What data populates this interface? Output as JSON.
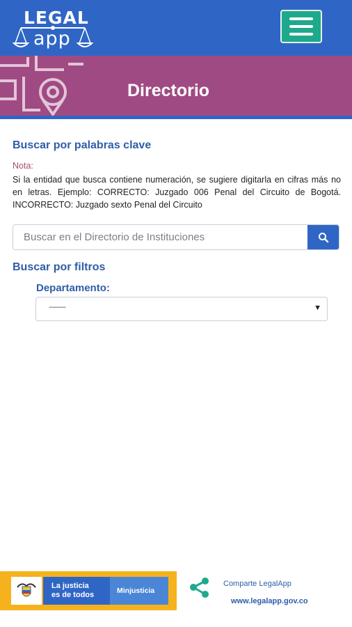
{
  "header": {
    "logo_top": "LEGAL",
    "logo_bottom": "app",
    "menu_icon": "hamburger-icon"
  },
  "banner": {
    "title": "Directorio"
  },
  "keyword_search": {
    "title": "Buscar por palabras clave",
    "note_label": "Nota:",
    "note_text": "Si la entidad que busca contiene numeración, se sugiere digitarla en cifras más no en letras. Ejemplo: CORRECTO: Juzgado 006 Penal del Circuito de Bogotá. INCORRECTO: Juzgado sexto Penal del Circuito",
    "search_placeholder": "Buscar en el Directorio de Instituciones",
    "search_value": "",
    "search_icon": "search-icon"
  },
  "filters": {
    "title": "Buscar por filtros",
    "department_label": "Departamento:",
    "department_value": "---------"
  },
  "footer": {
    "brand_main": "La justicia\nes de todos",
    "brand_ministry": "Minjusticia",
    "share_label": "Comparte LegalApp",
    "site_url": "www.legalapp.gov.co"
  },
  "colors": {
    "header_blue": "#2f66c6",
    "banner_magenta": "#a04a83",
    "menu_green": "#1fa98c",
    "accent_text": "#2e5da8",
    "footer_yellow": "#f5b21d"
  }
}
